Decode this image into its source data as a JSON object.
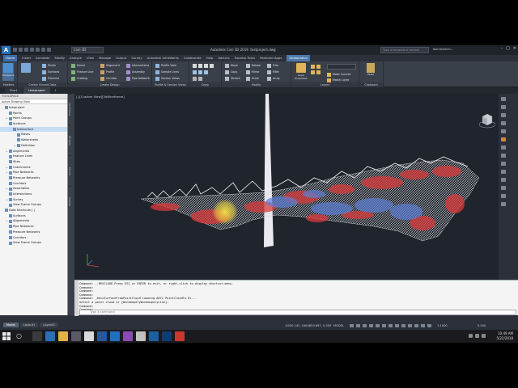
{
  "window": {
    "app_title": "Autodesk Civil 3D 2019",
    "doc_title": "testproject.dwg",
    "workspace": "Civil 3D",
    "search_placeholder": "Type a keyword or phrase",
    "user": "bob.bracken..."
  },
  "ribbon_tabs": [
    "Home",
    "Insert",
    "Annotate",
    "Modify",
    "Analyze",
    "View",
    "Manage",
    "Output",
    "Survey",
    "Autodesk InfraWorks",
    "Collaborate",
    "Help",
    "Add-ins",
    "Express Tools",
    "Featured Apps",
    "Geolocation"
  ],
  "ribbon": {
    "toolspace_label": "Toolspace",
    "ground_data": [
      {
        "icon": "points-icon",
        "label": "Points"
      },
      {
        "icon": "surfaces-icon",
        "label": "Surfaces"
      },
      {
        "icon": "traverse-icon",
        "label": "Traverse"
      }
    ],
    "parcel_group": [
      {
        "icon": "parcel-icon",
        "label": "Parcel"
      },
      {
        "icon": "feature-line-icon",
        "label": "Feature Line"
      },
      {
        "icon": "grading-icon",
        "label": "Grading"
      }
    ],
    "alignment_group": [
      {
        "icon": "alignment-icon",
        "label": "Alignment"
      },
      {
        "icon": "profile-icon",
        "label": "Profile"
      },
      {
        "icon": "corridor-icon",
        "label": "Corridor"
      }
    ],
    "intersections_group": [
      {
        "icon": "intersections-icon",
        "label": "Intersections"
      },
      {
        "icon": "assembly-icon",
        "label": "Assembly"
      },
      {
        "icon": "pipe-network-icon",
        "label": "Pipe Network"
      }
    ],
    "profile_views_group": [
      {
        "icon": "profile-view-icon",
        "label": "Profile View"
      },
      {
        "icon": "sample-lines-icon",
        "label": "Sample Lines"
      },
      {
        "icon": "section-views-icon",
        "label": "Section Views"
      }
    ],
    "modify_col1": [
      {
        "icon": "move-icon",
        "label": "Move"
      },
      {
        "icon": "copy-icon",
        "label": "Copy"
      },
      {
        "icon": "stretch-icon",
        "label": "Stretch"
      }
    ],
    "modify_col2": [
      {
        "icon": "rotate-icon",
        "label": "Rotate"
      },
      {
        "icon": "mirror-icon",
        "label": "Mirror"
      },
      {
        "icon": "scale-icon",
        "label": "Scale"
      }
    ],
    "modify_col3": [
      {
        "icon": "trim-icon",
        "label": "Trim"
      },
      {
        "icon": "fillet-icon",
        "label": "Fillet"
      },
      {
        "icon": "array-icon",
        "label": "Array"
      }
    ],
    "layer_props_label": "Layer Properties",
    "layer_actions": [
      "Make Current",
      "Match Layer"
    ],
    "paste_label": "Paste",
    "panel_titles": [
      "Palettes",
      "Create Ground Data",
      "Create Design",
      "Profile & Section Views",
      "Draw",
      "Modify",
      "Layers",
      "Clipboard"
    ]
  },
  "doc_tabs": [
    "Start",
    "testproject"
  ],
  "toolspace": {
    "header": "TOOLSPACE",
    "selector": "Active Drawing View",
    "tree": [
      {
        "label": "testproject",
        "level": 0,
        "twisty": "-"
      },
      {
        "label": "Points",
        "level": 1,
        "twisty": ""
      },
      {
        "label": "Point Groups",
        "level": 1,
        "twisty": "+"
      },
      {
        "label": "Surfaces",
        "level": 1,
        "twisty": "-"
      },
      {
        "label": "testsurface",
        "level": 2,
        "twisty": "-",
        "selected": true
      },
      {
        "label": "Masks",
        "level": 3,
        "twisty": ""
      },
      {
        "label": "Watersheds",
        "level": 3,
        "twisty": ""
      },
      {
        "label": "Definition",
        "level": 3,
        "twisty": "+"
      },
      {
        "label": "Alignments",
        "level": 1,
        "twisty": "+"
      },
      {
        "label": "Feature Lines",
        "level": 1,
        "twisty": ""
      },
      {
        "label": "Sites",
        "level": 1,
        "twisty": ""
      },
      {
        "label": "Catchments",
        "level": 1,
        "twisty": "+"
      },
      {
        "label": "Pipe Networks",
        "level": 1,
        "twisty": "+"
      },
      {
        "label": "Pressure Networks",
        "level": 1,
        "twisty": ""
      },
      {
        "label": "Corridors",
        "level": 1,
        "twisty": ""
      },
      {
        "label": "Assemblies",
        "level": 1,
        "twisty": "+"
      },
      {
        "label": "Intersections",
        "level": 1,
        "twisty": ""
      },
      {
        "label": "Survey",
        "level": 1,
        "twisty": "+"
      },
      {
        "label": "View Frame Groups",
        "level": 1,
        "twisty": ""
      },
      {
        "label": "Data Shortcuts [ ]",
        "level": 0,
        "twisty": "-"
      },
      {
        "label": "Surfaces",
        "level": 1,
        "twisty": ""
      },
      {
        "label": "Alignments",
        "level": 1,
        "twisty": "+"
      },
      {
        "label": "Pipe Networks",
        "level": 1,
        "twisty": ""
      },
      {
        "label": "Pressure Networks",
        "level": 1,
        "twisty": ""
      },
      {
        "label": "Corridors",
        "level": 1,
        "twisty": ""
      },
      {
        "label": "View Frame Groups",
        "level": 1,
        "twisty": ""
      }
    ],
    "side_tabs": [
      "Prospector",
      "Settings",
      "Survey",
      "Toolbox"
    ]
  },
  "viewport": {
    "label": "[-][Custom View][3dWireframe]"
  },
  "command": {
    "history": [
      "Command: _.REVCLOUD Press ESC or ENTER to exit, or right-click to display shortcut-menu.",
      "Command:",
      "Command:",
      "Command:",
      "Command: _AeccSurfaceFromPointCloud Loading AECC PointCloudTo Ol...",
      "Select a point cloud or [WindowpolyWindowpolyLine]:",
      "Command:",
      "Command:"
    ],
    "placeholder": "Type a command"
  },
  "statusbar": {
    "layout_tabs": [
      "Model",
      "Layout1",
      "Layout2"
    ],
    "coords": "-8050.142, 5464850.897, 0.000",
    "model": "MODEL",
    "scale": "1:1000",
    "zoom": "0.500"
  },
  "taskbar": {
    "time": "10:49 AM",
    "date": "5/22/2018",
    "apps": [
      {
        "icon": "task-view-icon",
        "color": "#3a3a3f"
      },
      {
        "icon": "edge-icon",
        "color": "#2a6fb8"
      },
      {
        "icon": "explorer-icon",
        "color": "#e3b341"
      },
      {
        "icon": "store-icon",
        "color": "#5a5a66"
      },
      {
        "icon": "chrome-icon",
        "color": "#d9d9d9"
      },
      {
        "icon": "word-icon",
        "color": "#2b579a"
      },
      {
        "icon": "mail-icon",
        "color": "#1f70c1"
      },
      {
        "icon": "photos-icon",
        "color": "#8a4bb3"
      },
      {
        "icon": "app-icon",
        "color": "#c1c1c1"
      },
      {
        "icon": "civil3d-icon",
        "color": "#1d5fa0"
      },
      {
        "icon": "recap-icon",
        "color": "#0f3c73"
      },
      {
        "icon": "revit-icon",
        "color": "#c8382b"
      }
    ]
  }
}
